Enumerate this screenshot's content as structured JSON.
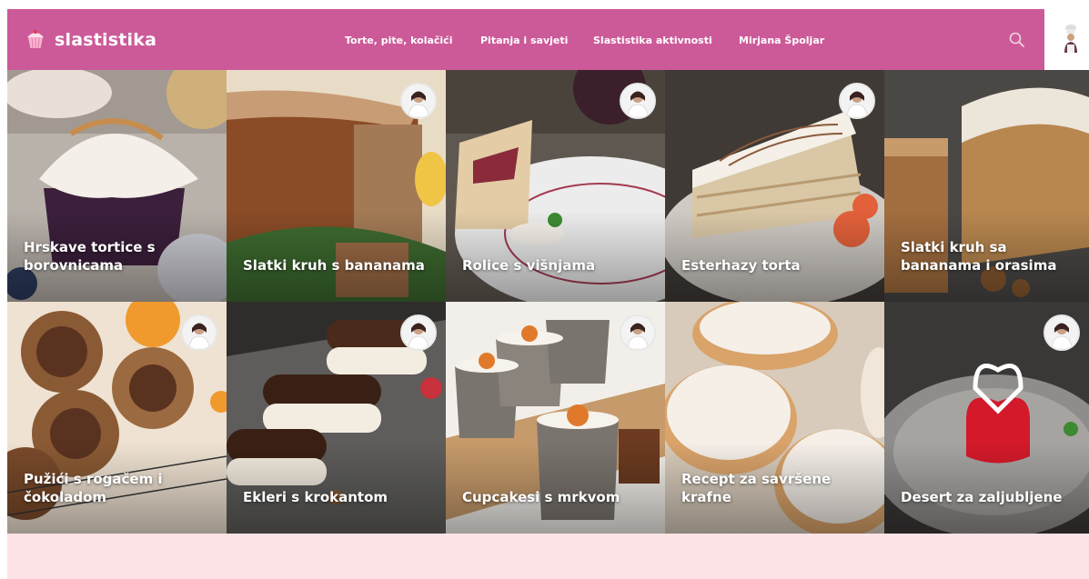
{
  "brand": {
    "name": "slastistika",
    "logo_icon": "cupcake-icon"
  },
  "nav": {
    "items": [
      {
        "label": "Torte, pite, kolačići"
      },
      {
        "label": "Pitanja i savjeti"
      },
      {
        "label": "Slastistika aktivnosti"
      },
      {
        "label": "Mirjana Špoljar"
      }
    ],
    "search_icon": "search-icon",
    "user_icon": "chef-icon"
  },
  "colors": {
    "brand_pink": "#cc5a99",
    "footer_pink": "#fde3e6",
    "text_on_brand": "#ffffff"
  },
  "recipes": [
    {
      "title": "Hrskave tortice s borovnicama",
      "has_author_badge": false
    },
    {
      "title": "Slatki kruh s bananama",
      "has_author_badge": true
    },
    {
      "title": "Rolice s višnjama",
      "has_author_badge": true
    },
    {
      "title": "Esterhazy torta",
      "has_author_badge": true
    },
    {
      "title": "Slatki kruh sa bananama i orasima",
      "has_author_badge": false
    },
    {
      "title": "Pužići s rogačem i čokoladom",
      "has_author_badge": true
    },
    {
      "title": "Ekleri s krokantom",
      "has_author_badge": true
    },
    {
      "title": "Cupcakesi s mrkvom",
      "has_author_badge": true
    },
    {
      "title": "Recept za savršene krafne",
      "has_author_badge": false
    },
    {
      "title": "Desert za zaljubljene",
      "has_author_badge": true
    }
  ]
}
